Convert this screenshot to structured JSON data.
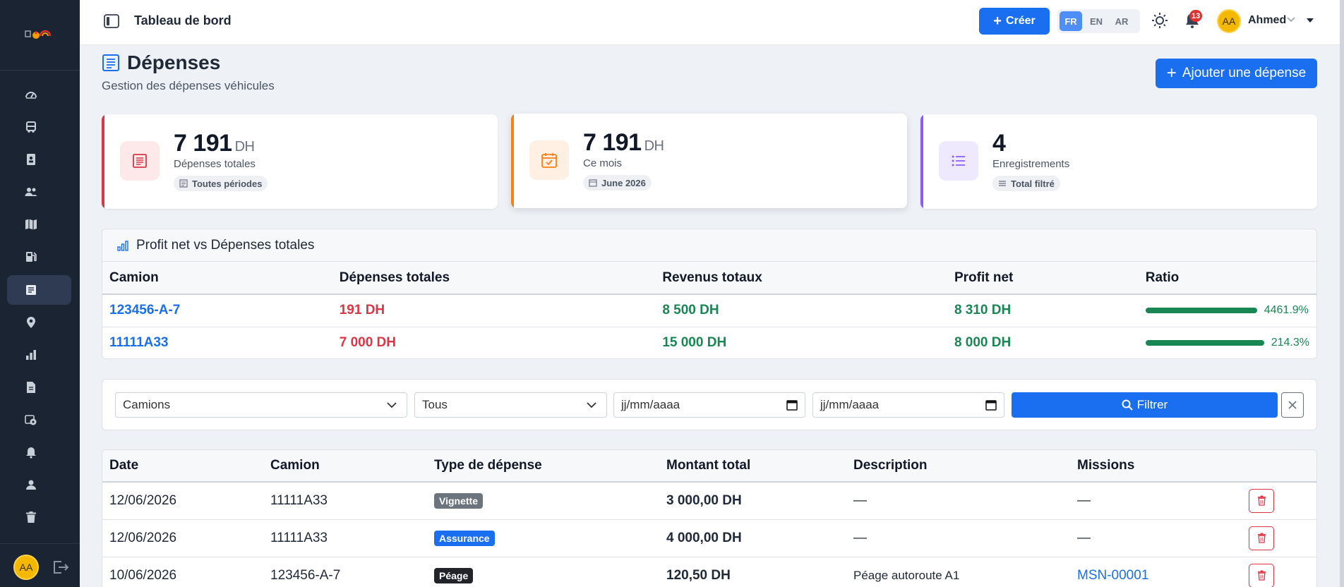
{
  "header": {
    "title": "Tableau de bord",
    "create_label": "Créer",
    "languages": [
      "FR",
      "EN",
      "AR"
    ],
    "active_language": "FR",
    "notification_count": "13",
    "user_initials": "AA",
    "user_name": "Ahmed"
  },
  "sidebar": {
    "items": [
      {
        "icon": "dashboard-icon"
      },
      {
        "icon": "truck-icon"
      },
      {
        "icon": "driver-card-icon"
      },
      {
        "icon": "users-icon"
      },
      {
        "icon": "map-icon"
      },
      {
        "icon": "fuel-icon"
      },
      {
        "icon": "expenses-icon",
        "active": true
      },
      {
        "icon": "location-icon"
      },
      {
        "icon": "chart-icon"
      },
      {
        "icon": "document-icon"
      },
      {
        "icon": "maintenance-icon"
      },
      {
        "icon": "bell-icon"
      },
      {
        "icon": "user-icon"
      },
      {
        "icon": "trash-icon"
      }
    ],
    "user_initials": "AA"
  },
  "page": {
    "title": "Dépenses",
    "subtitle": "Gestion des dépenses véhicules",
    "add_button": "Ajouter une dépense"
  },
  "stats": [
    {
      "value": "7 191",
      "unit": "DH",
      "label": "Dépenses totales",
      "chip": "Toutes périodes",
      "color": "#dc3545"
    },
    {
      "value": "7 191",
      "unit": "DH",
      "label": "Ce mois",
      "chip": "June 2026",
      "color": "#fd7e14"
    },
    {
      "value": "4",
      "unit": "",
      "label": "Enregistrements",
      "chip": "Total filtré",
      "color": "#8b5cf6"
    }
  ],
  "profit": {
    "title": "Profit net vs Dépenses totales",
    "columns": [
      "Camion",
      "Dépenses totales",
      "Revenus totaux",
      "Profit net",
      "Ratio"
    ],
    "rows": [
      {
        "truck": "123456-A-7",
        "expenses": "191 DH",
        "revenue": "8 500 DH",
        "profit": "8 310 DH",
        "ratio": "4461.9%"
      },
      {
        "truck": "11111A33",
        "expenses": "7 000 DH",
        "revenue": "15 000 DH",
        "profit": "8 000 DH",
        "ratio": "214.3%"
      }
    ]
  },
  "filter": {
    "truck_select": "Camions",
    "type_select": "Tous",
    "date_from_placeholder": "jj/mm/aaaa",
    "date_to_placeholder": "jj/mm/aaaa",
    "filter_button": "Filtrer"
  },
  "expenses": {
    "columns": [
      "Date",
      "Camion",
      "Type de dépense",
      "Montant total",
      "Description",
      "Missions"
    ],
    "rows": [
      {
        "date": "12/06/2026",
        "truck": "11111A33",
        "type": "Vignette",
        "type_color": "#6c757d",
        "amount": "3 000,00 DH",
        "description": "—",
        "mission": "—"
      },
      {
        "date": "12/06/2026",
        "truck": "11111A33",
        "type": "Assurance",
        "type_color": "#1a6ff0",
        "amount": "4 000,00 DH",
        "description": "—",
        "mission": "—"
      },
      {
        "date": "10/06/2026",
        "truck": "123456-A-7",
        "type": "Péage",
        "type_color": "#212529",
        "amount": "120,50 DH",
        "description": "Péage autoroute A1",
        "mission": "MSN-00001"
      }
    ]
  }
}
